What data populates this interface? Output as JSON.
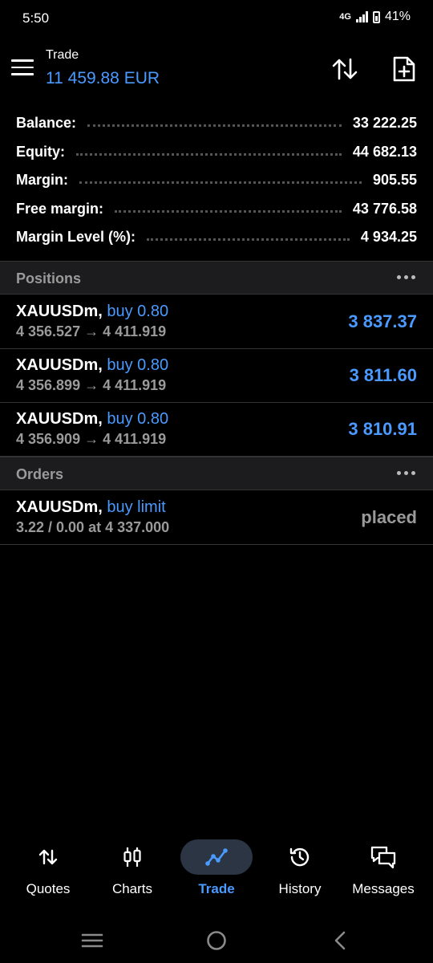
{
  "status_bar": {
    "time": "5:50",
    "network": "4G",
    "battery": "41%"
  },
  "header": {
    "title": "Trade",
    "balance": "11 459.88 EUR",
    "icons": [
      "menu-icon",
      "sort-icon",
      "new-order-icon"
    ]
  },
  "summary": [
    {
      "label": "Balance:",
      "value": "33 222.25"
    },
    {
      "label": "Equity:",
      "value": "44 682.13"
    },
    {
      "label": "Margin:",
      "value": "905.55"
    },
    {
      "label": "Free margin:",
      "value": "43 776.58"
    },
    {
      "label": "Margin Level (%):",
      "value": "4 934.25"
    }
  ],
  "positions": {
    "title": "Positions",
    "items": [
      {
        "symbol": "XAUUSDm,",
        "side": "buy 0.80",
        "prices": "4 356.527 → 4 411.919",
        "profit": "3 837.37"
      },
      {
        "symbol": "XAUUSDm,",
        "side": "buy 0.80",
        "prices": "4 356.899 → 4 411.919",
        "profit": "3 811.60"
      },
      {
        "symbol": "XAUUSDm,",
        "side": "buy 0.80",
        "prices": "4 356.909 → 4 411.919",
        "profit": "3 810.91"
      }
    ]
  },
  "orders": {
    "title": "Orders",
    "items": [
      {
        "symbol": "XAUUSDm,",
        "side": "buy limit",
        "details": "3.22 / 0.00 at 4 337.000",
        "status": "placed"
      }
    ]
  },
  "bottom_nav": [
    {
      "label": "Quotes",
      "icon": "quotes-icon",
      "active": false
    },
    {
      "label": "Charts",
      "icon": "charts-icon",
      "active": false
    },
    {
      "label": "Trade",
      "icon": "trade-icon",
      "active": true
    },
    {
      "label": "History",
      "icon": "history-icon",
      "active": false
    },
    {
      "label": "Messages",
      "icon": "messages-icon",
      "active": false
    }
  ],
  "colors": {
    "accent": "#4a9aff",
    "background": "#000000",
    "section": "#1c1c1e",
    "muted": "#9a9a9a"
  }
}
